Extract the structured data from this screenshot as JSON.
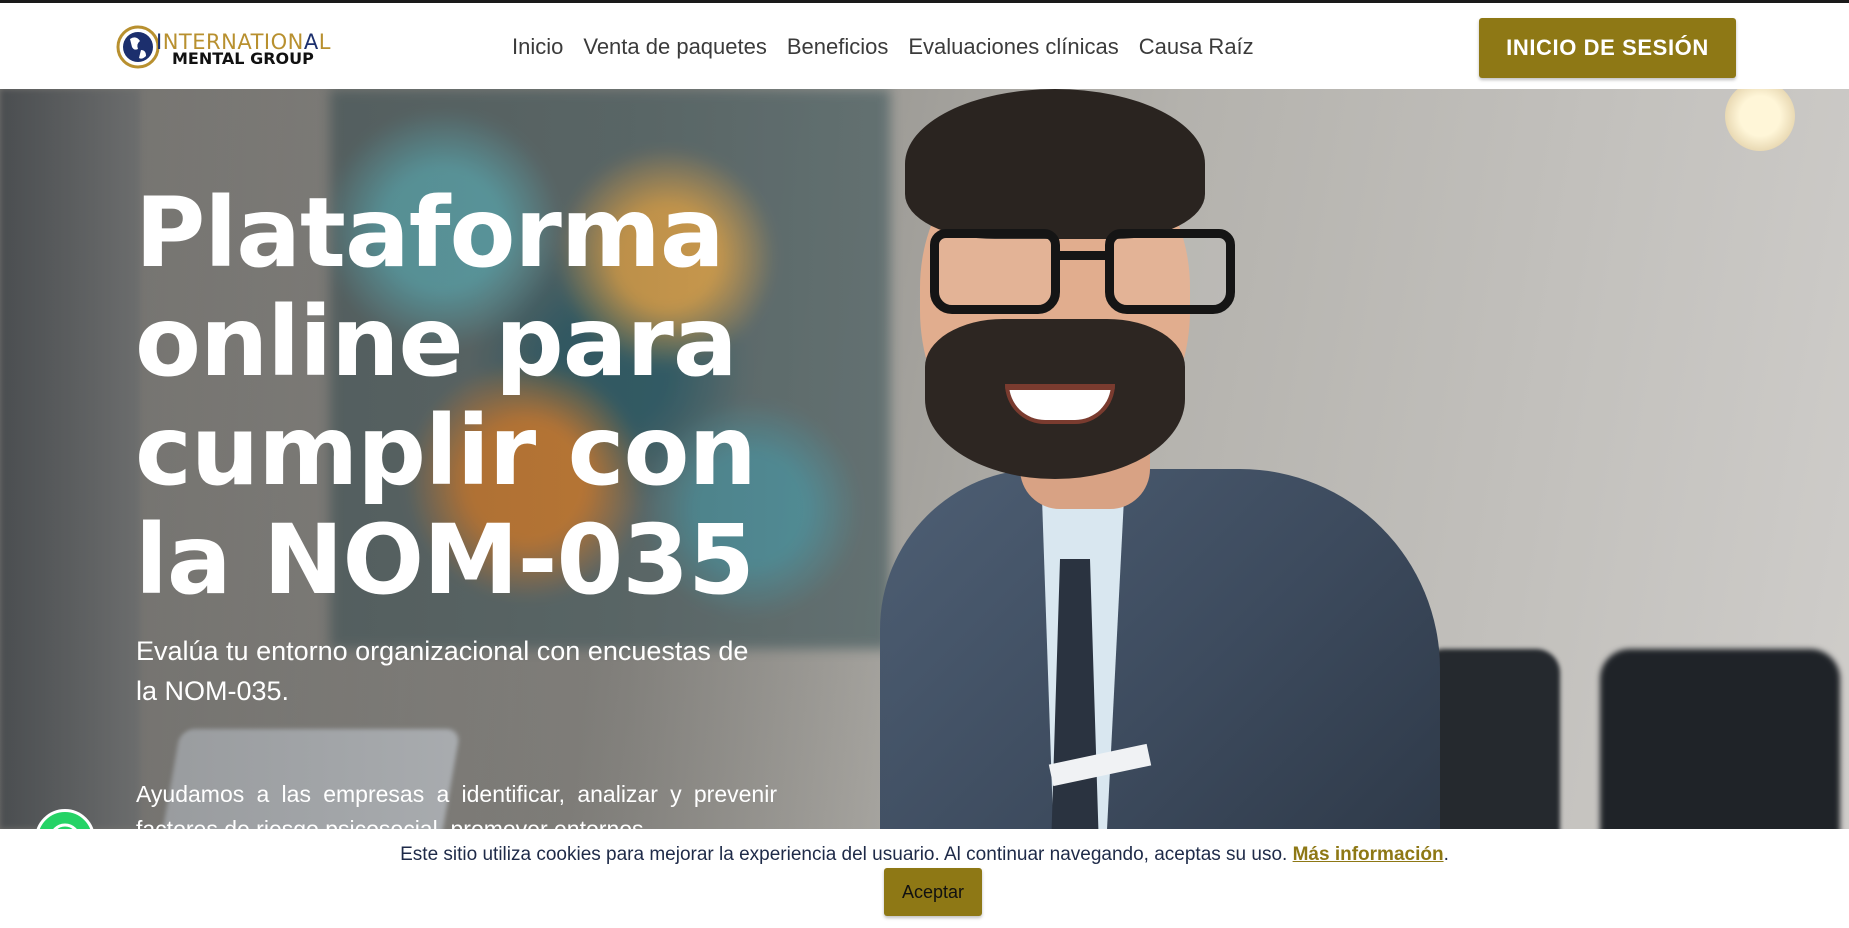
{
  "header": {
    "logo_line1": "INTERNATIONAL",
    "logo_line2": "MENTAL GROUP",
    "nav": [
      "Inicio",
      "Venta de paquetes",
      "Beneficios",
      "Evaluaciones clínicas",
      "Causa Raíz"
    ],
    "login_label": "INICIO DE SESIÓN"
  },
  "hero": {
    "title_lines": [
      "Plataforma",
      "online para",
      "cumplir con",
      "la NOM-035"
    ],
    "subtitle": "Evalúa tu entorno organizacional con encuestas de la NOM-035.",
    "body": "Ayudamos a las empresas a identificar, analizar y prevenir factores de riesgo psicosocial, promover entornos"
  },
  "cookie": {
    "text": "Este sitio utiliza cookies para mejorar la experiencia del usuario. Al continuar navegando, aceptas su uso.",
    "link": "Más información",
    "period": ".",
    "accept_label": "Aceptar"
  },
  "colors": {
    "accent": "#8e7815",
    "logo_gold": "#b8902f",
    "logo_navy": "#1c2f6d",
    "cookie_text": "#1e2a48",
    "whatsapp": "#25d366"
  },
  "icons": {
    "logo": "globe-logo-icon",
    "whatsapp": "whatsapp-icon"
  }
}
